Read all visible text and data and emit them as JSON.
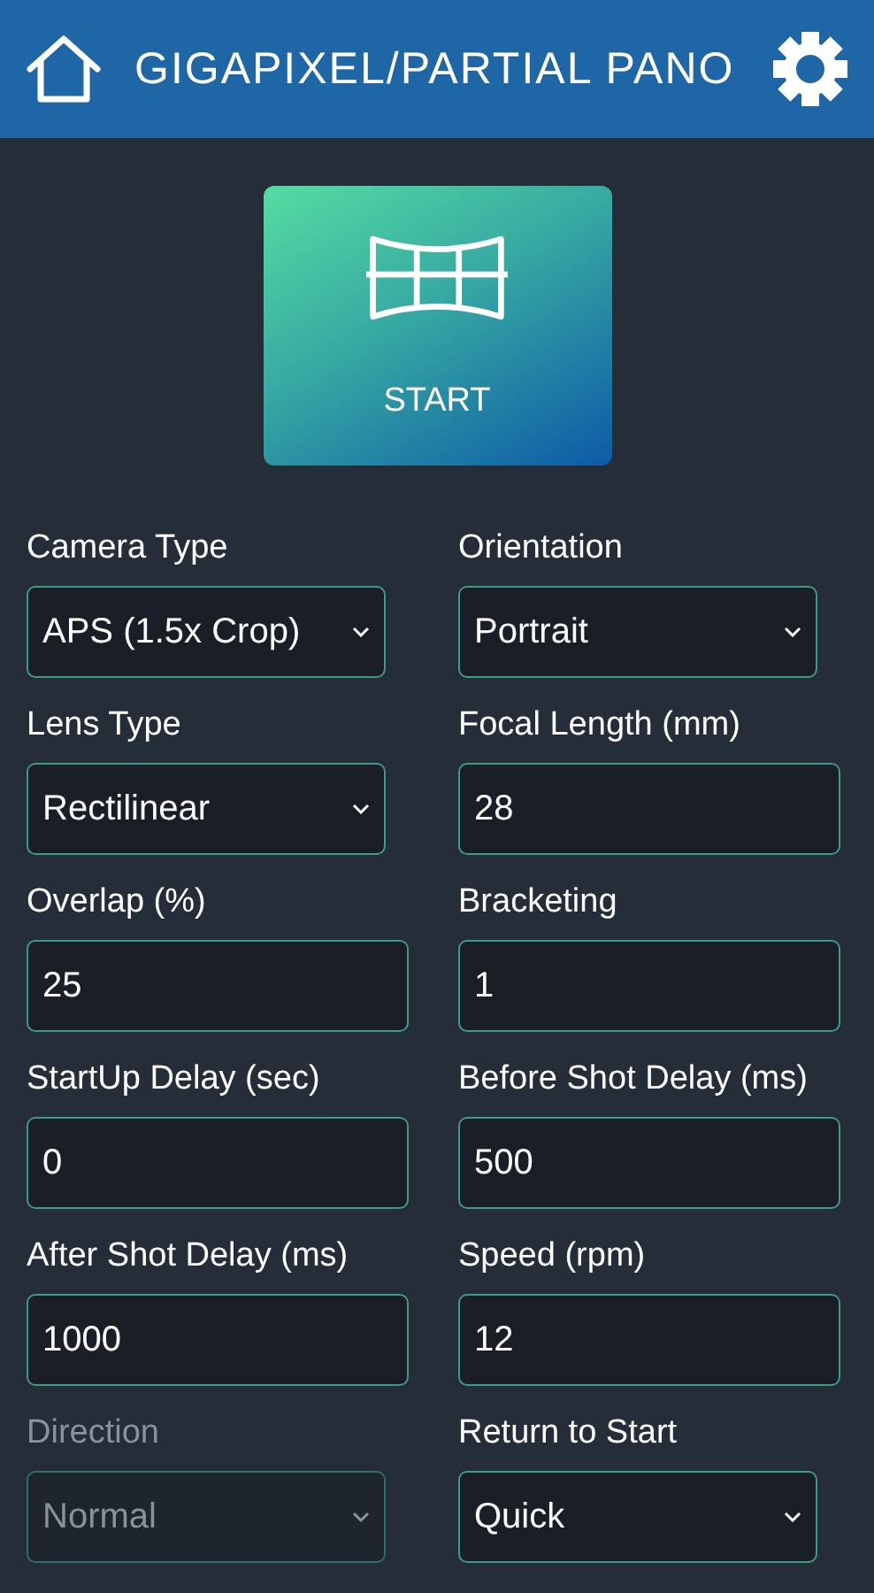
{
  "header": {
    "title": "GIGAPIXEL/PARTIAL PANO"
  },
  "start_button": {
    "label": "START"
  },
  "fields": [
    {
      "label": "Camera Type",
      "kind": "select",
      "value": "APS (1.5x Crop)",
      "disabled": false
    },
    {
      "label": "Orientation",
      "kind": "select",
      "value": "Portrait",
      "disabled": false
    },
    {
      "label": "Lens Type",
      "kind": "select",
      "value": "Rectilinear",
      "disabled": false
    },
    {
      "label": "Focal Length (mm)",
      "kind": "input",
      "value": "28",
      "disabled": false
    },
    {
      "label": "Overlap (%)",
      "kind": "input",
      "value": "25",
      "disabled": false
    },
    {
      "label": "Bracketing",
      "kind": "input",
      "value": "1",
      "disabled": false
    },
    {
      "label": "StartUp Delay (sec)",
      "kind": "input",
      "value": "0",
      "disabled": false
    },
    {
      "label": "Before Shot Delay (ms)",
      "kind": "input",
      "value": "500",
      "disabled": false
    },
    {
      "label": "After Shot Delay (ms)",
      "kind": "input",
      "value": "1000",
      "disabled": false
    },
    {
      "label": "Speed (rpm)",
      "kind": "input",
      "value": "12",
      "disabled": false
    },
    {
      "label": "Direction",
      "kind": "select",
      "value": "Normal",
      "disabled": true
    },
    {
      "label": "Return to Start",
      "kind": "select",
      "value": "Quick",
      "disabled": false
    }
  ]
}
